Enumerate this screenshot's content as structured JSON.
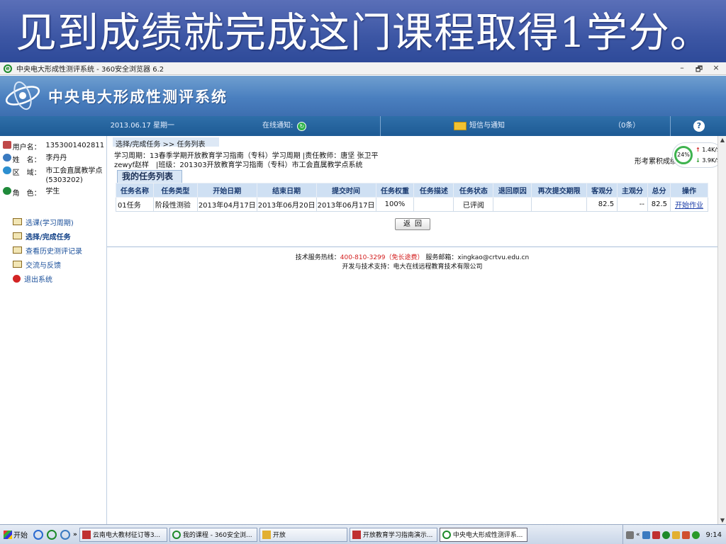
{
  "caption": "见到成绩就完成这门课程取得1学分。",
  "browser": {
    "title": "中央电大形成性测评系统 - 360安全浏览器 6.2",
    "min": "–",
    "restore": "🗗",
    "close": "×"
  },
  "site": {
    "title": "中央电大形成性测评系统"
  },
  "infobar": {
    "date": "2013.06.17 星期一",
    "notice_label": "在线通知:",
    "messages": "短信与通知",
    "count": "（0条）",
    "help": "?"
  },
  "user": {
    "username_label": "用户名：",
    "username": "1353001402811",
    "name_label": "姓　名：",
    "name": "李丹丹",
    "region_label": "区　域：",
    "region": "市工会直属教学点(5303202)",
    "role_label": "角　色：",
    "role": "学生"
  },
  "nav": [
    {
      "label": "选课(学习周期)"
    },
    {
      "label": "选择/完成任务"
    },
    {
      "label": "查看历史测评记录"
    },
    {
      "label": "交流与反馈"
    },
    {
      "label": "退出系统"
    }
  ],
  "main": {
    "breadcrumb": "选择/完成任务 >> 任务列表",
    "info_line1": "学习周期：13春季学期开放教育学习指南（专科）学习周期 |责任教师：唐坚 张卫平",
    "info_line2": "zewyf赵样　|班级：201303开放教育学习指南（专科）市工会直属教学点系统",
    "score_label": "形考累积成绩",
    "tab_title": "我的任务列表",
    "columns": [
      "任务名称",
      "任务类型",
      "开始日期",
      "结束日期",
      "提交时间",
      "任务权重",
      "任务描述",
      "任务状态",
      "退回原因",
      "再次提交期限",
      "客观分",
      "主观分",
      "总分",
      "操作"
    ],
    "rows": [
      {
        "name": "01任务",
        "type": "阶段性测验",
        "start": "2013年04月17日",
        "end": "2013年06月20日",
        "submitted": "2013年06月17日",
        "weight": "100%",
        "desc": "",
        "status": "已评阅",
        "reason": "",
        "deadline": "",
        "objective": "82.5",
        "subjective": "--",
        "total": "82.5",
        "action": "开始作业"
      }
    ],
    "back_button": "返回",
    "footer_hotline_label": "技术服务热线：",
    "footer_hotline": "400-810-3299（免长途费）",
    "footer_email": "服务邮箱：xingkao@crtvu.edu.cn",
    "footer_support": "开发与技术支持：电大在线远程教育技术有限公司"
  },
  "speed": {
    "percent": "24%",
    "up": "1.4K/S",
    "down": "3.9K/S"
  },
  "taskbar": {
    "start": "开始",
    "chevron": "»",
    "tasks": [
      {
        "label": "云南电大教材征订等3...",
        "color": "#c03030"
      },
      {
        "label": "我的课程 - 360安全浏...",
        "color": "#1d8a2a"
      },
      {
        "label": "开放",
        "color": "#e2b030"
      },
      {
        "label": "开放教育学习指南演示...",
        "color": "#c03030"
      },
      {
        "label": "中央电大形成性测评系...",
        "color": "#1d8a2a"
      }
    ],
    "tray_chevron": "«",
    "clock": "9:14"
  }
}
